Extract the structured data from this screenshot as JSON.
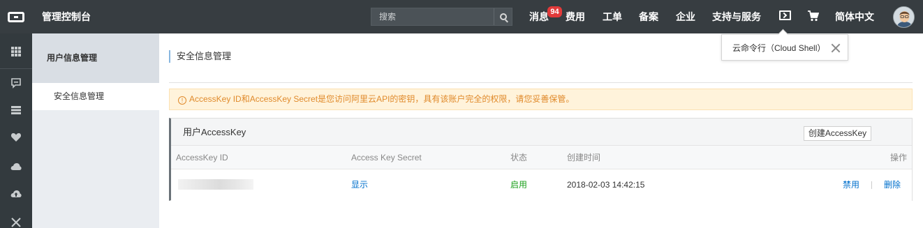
{
  "header": {
    "console_title": "管理控制台",
    "search": {
      "placeholder": "搜索"
    },
    "nav": {
      "messages": "消息",
      "messages_badge": "94",
      "billing": "费用",
      "tickets": "工单",
      "icp": "备案",
      "enterprise": "企业",
      "support": "支持与服务",
      "language": "简体中文"
    },
    "icons": [
      "aliyun-logo-icon",
      "search-icon",
      "cloud-shell-icon",
      "cart-icon",
      "avatar"
    ]
  },
  "rail": {
    "icons": [
      "grid-icon",
      "chat-icon",
      "server-icon",
      "heart-icon",
      "cloud-icon",
      "cloud-upload-icon",
      "crossed-icon"
    ]
  },
  "sidebar": {
    "title": "用户信息管理",
    "items": [
      {
        "label": "安全信息管理",
        "active": true
      }
    ]
  },
  "main": {
    "page_title": "安全信息管理",
    "alert": {
      "icon": "!",
      "text": "AccessKey ID和AccessKey Secret是您访问阿里云API的密钥，具有该账户完全的权限，请您妥善保管。"
    },
    "panel": {
      "title": "用户AccessKey",
      "create_button": "创建AccessKey",
      "columns": [
        "AccessKey ID",
        "Access Key Secret",
        "状态",
        "创建时间",
        "操作"
      ],
      "rows": [
        {
          "access_key_id": "",
          "secret_action": "显示",
          "status": "启用",
          "created": "2018-02-03 14:42:15",
          "actions": [
            "禁用",
            "删除"
          ]
        }
      ]
    }
  },
  "popover": {
    "text": "云命令行（Cloud Shell）"
  },
  "colors": {
    "topbar": "#373d41",
    "accent_link": "#0070cc",
    "status_ok": "#1ca01c",
    "alert_text": "#e08a2b",
    "alert_bg": "#fff3db",
    "badge": "#e23a3a"
  }
}
